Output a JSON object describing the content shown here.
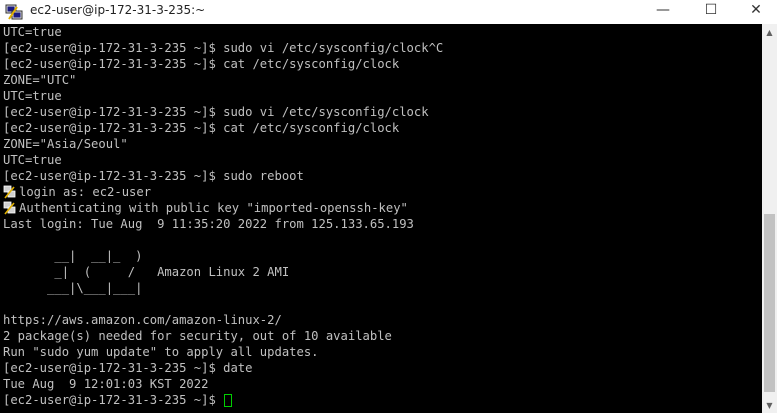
{
  "window": {
    "title": "ec2-user@ip-172-31-3-235:~",
    "app_icon": "putty-icon",
    "controls": {
      "minimize": "—",
      "maximize": "☐",
      "close": "✕"
    }
  },
  "terminal": {
    "prompt": "[ec2-user@ip-172-31-3-235 ~]$ ",
    "lines": [
      "UTC=true",
      "[ec2-user@ip-172-31-3-235 ~]$ sudo vi /etc/sysconfig/clock^C",
      "[ec2-user@ip-172-31-3-235 ~]$ cat /etc/sysconfig/clock",
      "ZONE=\"UTC\"",
      "UTC=true",
      "[ec2-user@ip-172-31-3-235 ~]$ sudo vi /etc/sysconfig/clock",
      "[ec2-user@ip-172-31-3-235 ~]$ cat /etc/sysconfig/clock",
      "ZONE=\"Asia/Seoul\"",
      "UTC=true",
      "[ec2-user@ip-172-31-3-235 ~]$ sudo reboot",
      "login as: ec2-user",
      "Authenticating with public key \"imported-openssh-key\"",
      "Last login: Tue Aug  9 11:35:20 2022 from 125.133.65.193",
      "",
      "       __|  __|_  )",
      "       _|  (     /   Amazon Linux 2 AMI",
      "      ___|\\___|___|",
      "",
      "https://aws.amazon.com/amazon-linux-2/",
      "2 package(s) needed for security, out of 10 available",
      "Run \"sudo yum update\" to apply all updates.",
      "[ec2-user@ip-172-31-3-235 ~]$ date",
      "Tue Aug  9 12:01:03 KST 2022"
    ],
    "key_icon_lines": [
      10,
      11
    ],
    "cursor_color": "#00d000",
    "text_color": "#c0c0c0",
    "background": "#000000"
  },
  "scrollbar": {
    "up_icon": "▲",
    "down_icon": "▼"
  }
}
